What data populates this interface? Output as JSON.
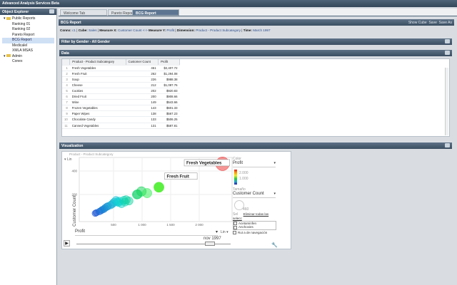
{
  "app": {
    "title": "Advanced Analysis Services Beta"
  },
  "explorer": {
    "title": "Object Explorer",
    "items": [
      {
        "label": "Public Reports",
        "level": 0,
        "folder": true
      },
      {
        "label": "Ranking 01",
        "level": 1
      },
      {
        "label": "Ranking 02",
        "level": 1
      },
      {
        "label": "Pareto Report",
        "level": 1
      },
      {
        "label": "BCG Report",
        "level": 1,
        "selected": true
      },
      {
        "label": "Medicalel",
        "level": 1
      },
      {
        "label": "XMLA MSAS",
        "level": 1
      },
      {
        "label": "Admin",
        "level": 0,
        "folder": true
      },
      {
        "label": "Conex",
        "level": 1
      }
    ]
  },
  "tabs": [
    {
      "label": "Welcome Tab"
    },
    {
      "label": "Pareto Report"
    },
    {
      "label": "BCG Report",
      "active": true
    }
  ],
  "report": {
    "title": "BCG Report",
    "actions": [
      "Show Cube",
      "Save",
      "Save As"
    ],
    "breadcrumb": {
      "k1": "Connx:",
      "v1": "c1",
      "k2": "Cube:",
      "v2": "Sales",
      "k3": "Measure X:",
      "v3": "Customer Count",
      "arrow": "<->",
      "k4": "Measure Y:",
      "v4": "Profit",
      "k5": "Dimension:",
      "v5": "Product - Product Subcategory",
      "k6": "Time:",
      "v6": "March 1997",
      "sep": "|"
    }
  },
  "filter": {
    "title": "Filter by Gender - All Gender"
  },
  "data": {
    "title": "Data",
    "columns": [
      "Product - Product Subcategory",
      "Customer Count",
      "Profit"
    ],
    "rows": [
      [
        "1",
        "Fresh Vegetables",
        "461",
        "$2,407.72"
      ],
      [
        "2",
        "Fresh Fruit",
        "262",
        "$1,294.08"
      ],
      [
        "3",
        "Soup",
        "226",
        "$988.38"
      ],
      [
        "4",
        "Cheese",
        "212",
        "$1,087.76"
      ],
      [
        "5",
        "Cookies",
        "202",
        "$920.83"
      ],
      [
        "6",
        "Dried Fruit",
        "200",
        "$908.66"
      ],
      [
        "7",
        "Wine",
        "149",
        "$543.66"
      ],
      [
        "8",
        "Frozen Vegetables",
        "143",
        "$601.33"
      ],
      [
        "9",
        "Paper Wipes",
        "138",
        "$567.23"
      ],
      [
        "10",
        "Chocolate Candy",
        "133",
        "$506.25"
      ],
      [
        "11",
        "Canned Vegetables",
        "131",
        "$587.81"
      ]
    ]
  },
  "viz": {
    "title": "Visualization",
    "chart_title": "Product - Product Subcategory",
    "y_scale": "Lin",
    "x_scale": "Lin",
    "x_selector": "Profit",
    "time_label": "nov 1997",
    "color_label": "Color",
    "color_value": "Profit",
    "color_ticks": [
      "2.000",
      "1.000"
    ],
    "size_label": "Tamaño",
    "size_value": "Customer Count",
    "size_tick": "460",
    "sel_label": "Sel",
    "sel_clear": "Eliminar todas las selecc",
    "sel_items": [
      "Acetaminfen",
      "Anchovies"
    ],
    "trail_label": "Rut a de navegación",
    "tooltips": [
      "Fresh Vegetables",
      "Fresh Fruit"
    ]
  },
  "chart_data": {
    "type": "scatter",
    "title": "Product - Product Subcategory",
    "xlabel": "Profit",
    "ylabel": "Customer Count",
    "xticks": [
      "500",
      "1 000",
      "1 500",
      "2 000"
    ],
    "yticks": [
      "400",
      "200"
    ],
    "xlim": [
      0,
      2600
    ],
    "ylim": [
      0,
      520
    ],
    "points": [
      {
        "label": "Fresh Vegetables",
        "x": 2407.72,
        "y": 461
      },
      {
        "label": "Fresh Fruit",
        "x": 1294.08,
        "y": 262
      },
      {
        "label": "Soup",
        "x": 988.38,
        "y": 226
      },
      {
        "label": "Cheese",
        "x": 1087.76,
        "y": 212
      },
      {
        "label": "Cookies",
        "x": 920.83,
        "y": 202
      },
      {
        "label": "Dried Fruit",
        "x": 908.66,
        "y": 200
      },
      {
        "label": "Wine",
        "x": 543.66,
        "y": 149
      },
      {
        "label": "Frozen Vegetables",
        "x": 601.33,
        "y": 143
      },
      {
        "label": "Paper Wipes",
        "x": 567.23,
        "y": 138
      },
      {
        "label": "Chocolate Candy",
        "x": 506.25,
        "y": 133
      },
      {
        "label": "Canned Vegetables",
        "x": 587.81,
        "y": 131
      },
      {
        "x": 680,
        "y": 150
      },
      {
        "x": 720,
        "y": 155
      },
      {
        "x": 640,
        "y": 120
      },
      {
        "x": 450,
        "y": 110
      },
      {
        "x": 400,
        "y": 100
      },
      {
        "x": 350,
        "y": 85
      },
      {
        "x": 300,
        "y": 70
      },
      {
        "x": 250,
        "y": 55
      },
      {
        "x": 200,
        "y": 45
      },
      {
        "x": 180,
        "y": 40
      },
      {
        "x": 480,
        "y": 120
      },
      {
        "x": 380,
        "y": 95
      },
      {
        "x": 330,
        "y": 75
      },
      {
        "x": 280,
        "y": 62
      },
      {
        "x": 700,
        "y": 135
      },
      {
        "x": 770,
        "y": 145
      }
    ]
  }
}
